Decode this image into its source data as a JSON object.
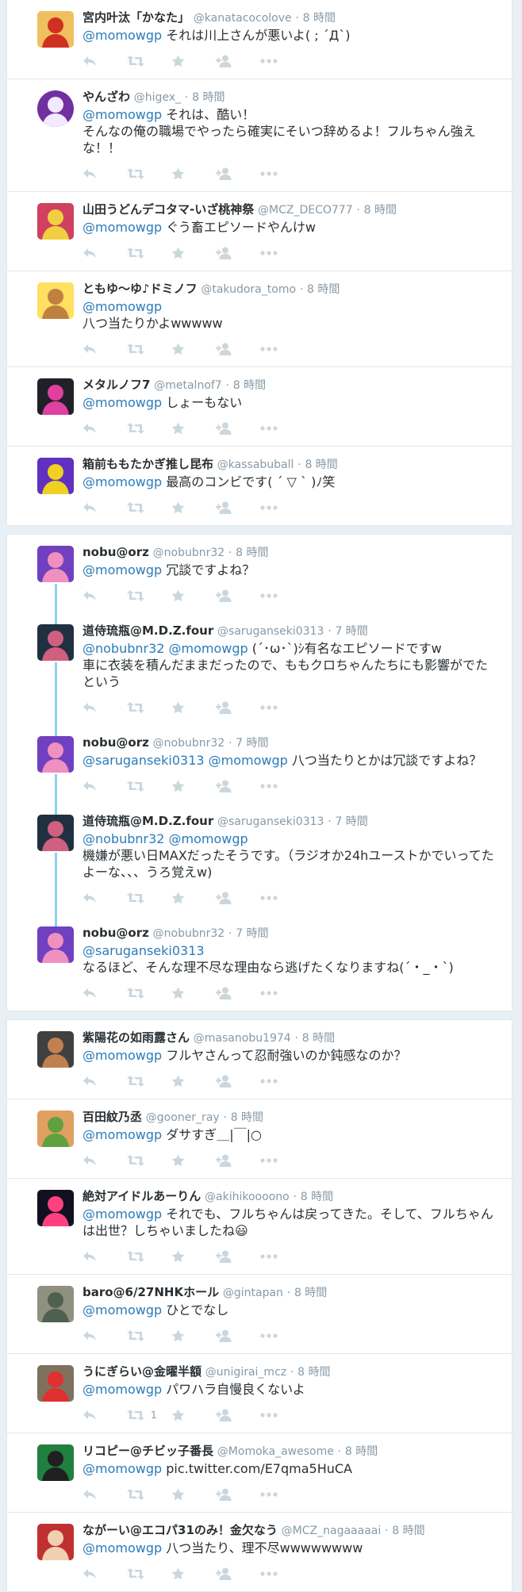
{
  "colors": {
    "accent": "#2b7bb9",
    "muted": "#8899a6",
    "icon": "#ccd6dd",
    "thread_line": "#8bd0f0",
    "background": "#e9f0f5"
  },
  "icons": {
    "reply": "reply-icon",
    "retweet": "retweet-icon",
    "favorite": "star-icon",
    "follow": "follow-icon",
    "more": "more-icon"
  },
  "groups": [
    {
      "tweets": [
        {
          "name": "宮内叶汰「かなた」",
          "handle": "@kanatacocolove",
          "sep": "·",
          "time": "8 時間",
          "mentions": "@momowgp",
          "text": "それは川上さんが悪いよ( ; ´Д`)"
        },
        {
          "name": "やんざわ",
          "handle": "@higex_",
          "sep": "·",
          "time": "8 時間",
          "mentions": "@momowgp",
          "text": "それは、酷い！\nそんなの俺の職場でやったら確実にそいつ辞めるよ！フルちゃん強えな！！"
        },
        {
          "name": "山田うどんデコタマ-いざ桃神祭",
          "handle": "@MCZ_DECO777",
          "sep": "·",
          "time": "8 時間",
          "mentions": "@momowgp",
          "text": "ぐう畜エピソードやんけw"
        },
        {
          "name": "ともゆ〜ゆ♪ドミノフ",
          "handle": "@takudora_tomo",
          "sep": "·",
          "time": "8 時間",
          "mentions": "@momowgp",
          "text": "\n八つ当たりかよwwwww"
        },
        {
          "name": "メタルノフ7",
          "handle": "@metalnof7",
          "sep": "·",
          "time": "8 時間",
          "mentions": "@momowgp",
          "text": "しょーもない"
        },
        {
          "name": "箱前ももたかぎ推し昆布",
          "handle": "@kassabuball",
          "sep": "·",
          "time": "8 時間",
          "mentions": "@momowgp",
          "text": "最高のコンビです( ´ ▽ ` )ﾉ笑"
        }
      ]
    },
    {
      "tweets": [
        {
          "name": "nobu@orz",
          "handle": "@nobubnr32",
          "sep": "·",
          "time": "8 時間",
          "mentions": "@momowgp",
          "text": "冗談ですよね？"
        },
        {
          "name": "道侍琉瓶@M.D.Z.four",
          "handle": "@saruganseki0313",
          "sep": "·",
          "time": "7 時間",
          "mentions": "@nobubnr32 @momowgp",
          "text": "(´･ω･`)ｼ有名なエピソードですw\n車に衣装を積んだままだったので、ももクロちゃんたちにも影響がでたという"
        },
        {
          "name": "nobu@orz",
          "handle": "@nobubnr32",
          "sep": "·",
          "time": "7 時間",
          "mentions": "@saruganseki0313 @momowgp",
          "text": "八つ当たりとかは冗談ですよね？"
        },
        {
          "name": "道侍琉瓶@M.D.Z.four",
          "handle": "@saruganseki0313",
          "sep": "·",
          "time": "7 時間",
          "mentions": "@nobubnr32 @momowgp",
          "text": "\n機嫌が悪い日MAXだったそうです。（ラジオか24hユーストかでいってたよーな、、、うろ覚えw)"
        },
        {
          "name": "nobu@orz",
          "handle": "@nobubnr32",
          "sep": "·",
          "time": "7 時間",
          "mentions": "@saruganseki0313",
          "text": "\nなるほど、そんな理不尽な理由なら逃げたくなりますね(´・_・`)"
        }
      ]
    },
    {
      "tweets": [
        {
          "name": "紫陽花の如雨露さん",
          "handle": "@masanobu1974",
          "sep": "·",
          "time": "8 時間",
          "mentions": "@momowgp",
          "text": "フルヤさんって忍耐強いのか鈍感なのか？"
        },
        {
          "name": "百田紋乃丞",
          "handle": "@gooner_ray",
          "sep": "·",
          "time": "8 時間",
          "mentions": "@momowgp",
          "text": "ダサすぎ＿|￣|○"
        },
        {
          "name": "絶対アイドルあーりん",
          "handle": "@akihikoooono",
          "sep": "·",
          "time": "8 時間",
          "mentions": "@momowgp",
          "text": "それでも、フルちゃんは戻ってきた。そして、フルちゃんは出世？しちゃいましたね😃"
        },
        {
          "name": "baro@6/27NHKホール",
          "handle": "@gintapan",
          "sep": "·",
          "time": "8 時間",
          "mentions": "@momowgp",
          "text": "ひとでなし"
        },
        {
          "name": "うにぎらい@金曜半額",
          "handle": "@unigirai_mcz",
          "sep": "·",
          "time": "8 時間",
          "mentions": "@momowgp",
          "text": "パワハラ自慢良くないよ",
          "rt_count": "1"
        },
        {
          "name": "リコピー@チビッ子番長",
          "handle": "@Momoka_awesome",
          "sep": "·",
          "time": "8 時間",
          "mentions": "@momowgp",
          "text": "pic.twitter.com/E7qma5HuCA"
        },
        {
          "name": "ながーい@エコパ31のみ！金欠なう",
          "handle": "@MCZ_nagaaaaai",
          "sep": "·",
          "time": "8 時間",
          "mentions": "@momowgp",
          "text": "八つ当たり、理不尽wwwwwwww"
        }
      ]
    }
  ]
}
